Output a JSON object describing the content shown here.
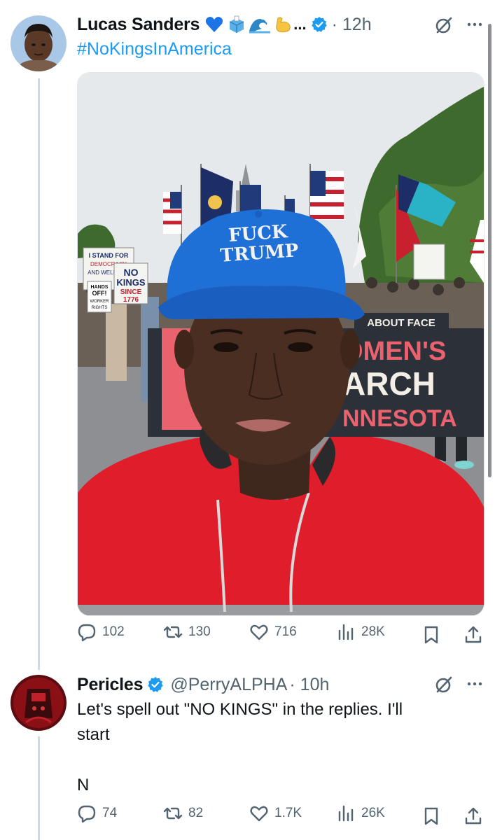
{
  "tweet1": {
    "name": "Lucas Sanders",
    "emoji_trail": "...",
    "time": "· 12h",
    "hashtag": "#NoKingsInAmerica",
    "media_text": {
      "hat_line1": "FUCK",
      "hat_line2": "TRUMP",
      "banner_line1": "OMEN'S",
      "banner_line2": "ARCH",
      "banner_line3": "NNESOTA",
      "banner_top": "ABOUT FACE",
      "sign1_line1": "I STAND FOR",
      "sign1_line2": "DEMOCRACY",
      "sign1_line3": "AND WELL FOR",
      "sign2_line1": "NO",
      "sign2_line2": "KINGS",
      "sign2_line3": "SINCE",
      "sign2_line4": "1776",
      "sign3_line1": "HANDS",
      "sign3_line2": "OFF!",
      "sign3_line3": "WORKER",
      "sign3_line4": "RIGHTS"
    },
    "stats": {
      "replies": "102",
      "reposts": "130",
      "likes": "716",
      "views": "28K"
    }
  },
  "tweet2": {
    "name": "Pericles",
    "handle": "@PerryALPHA",
    "time": "· 10h",
    "text": "Let's spell out \"NO KINGS\" in the replies. I'll\nstart\n\nN",
    "stats": {
      "replies": "74",
      "reposts": "82",
      "likes": "1.7K",
      "views": "26K"
    }
  },
  "icons": [
    "heart-emoji",
    "ballot-box-emoji",
    "wave-emoji",
    "flexed-biceps-emoji",
    "verified-badge-icon",
    "grok-icon",
    "more-icon",
    "reply-icon",
    "repost-icon",
    "like-icon",
    "views-icon",
    "bookmark-icon",
    "share-icon"
  ],
  "colors": {
    "link": "#1d9bf0",
    "muted": "#536471",
    "verified": "#1d9bf0",
    "hoodie": "#e01e2b",
    "cap": "#1e6fd6"
  }
}
